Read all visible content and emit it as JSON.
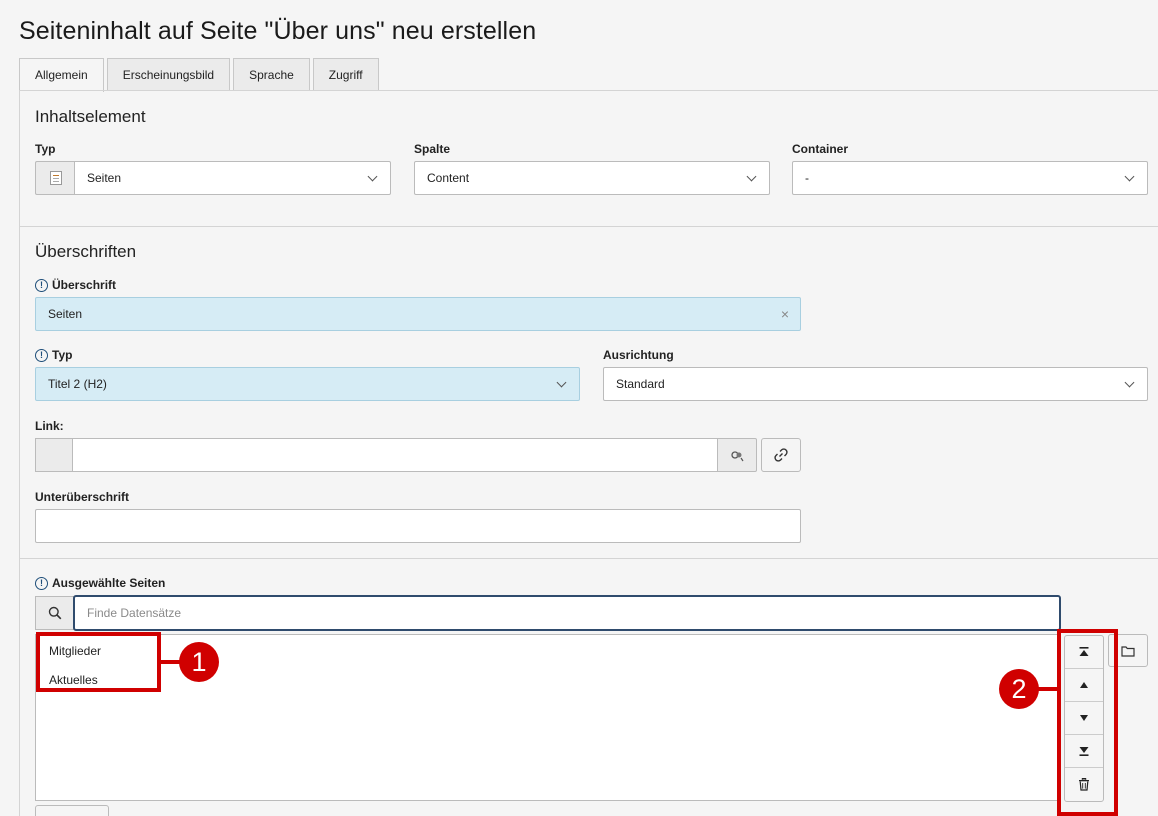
{
  "page": {
    "title": "Seiteninhalt auf Seite \"Über uns\" neu erstellen"
  },
  "tabs": [
    {
      "label": "Allgemein",
      "active": true
    },
    {
      "label": "Erscheinungsbild",
      "active": false
    },
    {
      "label": "Sprache",
      "active": false
    },
    {
      "label": "Zugriff",
      "active": false
    }
  ],
  "inhaltselement": {
    "section_title": "Inhaltselement",
    "typ": {
      "label": "Typ",
      "value": "Seiten"
    },
    "spalte": {
      "label": "Spalte",
      "value": "Content"
    },
    "container": {
      "label": "Container",
      "value": "-"
    }
  },
  "ueberschriften": {
    "section_title": "Überschriften",
    "ueberschrift": {
      "label": "Überschrift",
      "value": "Seiten"
    },
    "typ": {
      "label": "Typ",
      "value": "Titel 2 (H2)"
    },
    "ausrichtung": {
      "label": "Ausrichtung",
      "value": "Standard"
    },
    "link": {
      "label": "Link:",
      "value": ""
    },
    "unterueberschrift": {
      "label": "Unterüberschrift",
      "value": ""
    }
  },
  "ausgewaehlte": {
    "label": "Ausgewählte Seiten",
    "search_placeholder": "Finde Datensätze",
    "items": [
      "Mitglieder",
      "Aktuelles"
    ]
  },
  "annotations": {
    "badge1": "1",
    "badge2": "2"
  },
  "colors": {
    "highlight": "#d6ecf5",
    "annotation": "#d00000",
    "focus_border": "#2f4b6d"
  }
}
